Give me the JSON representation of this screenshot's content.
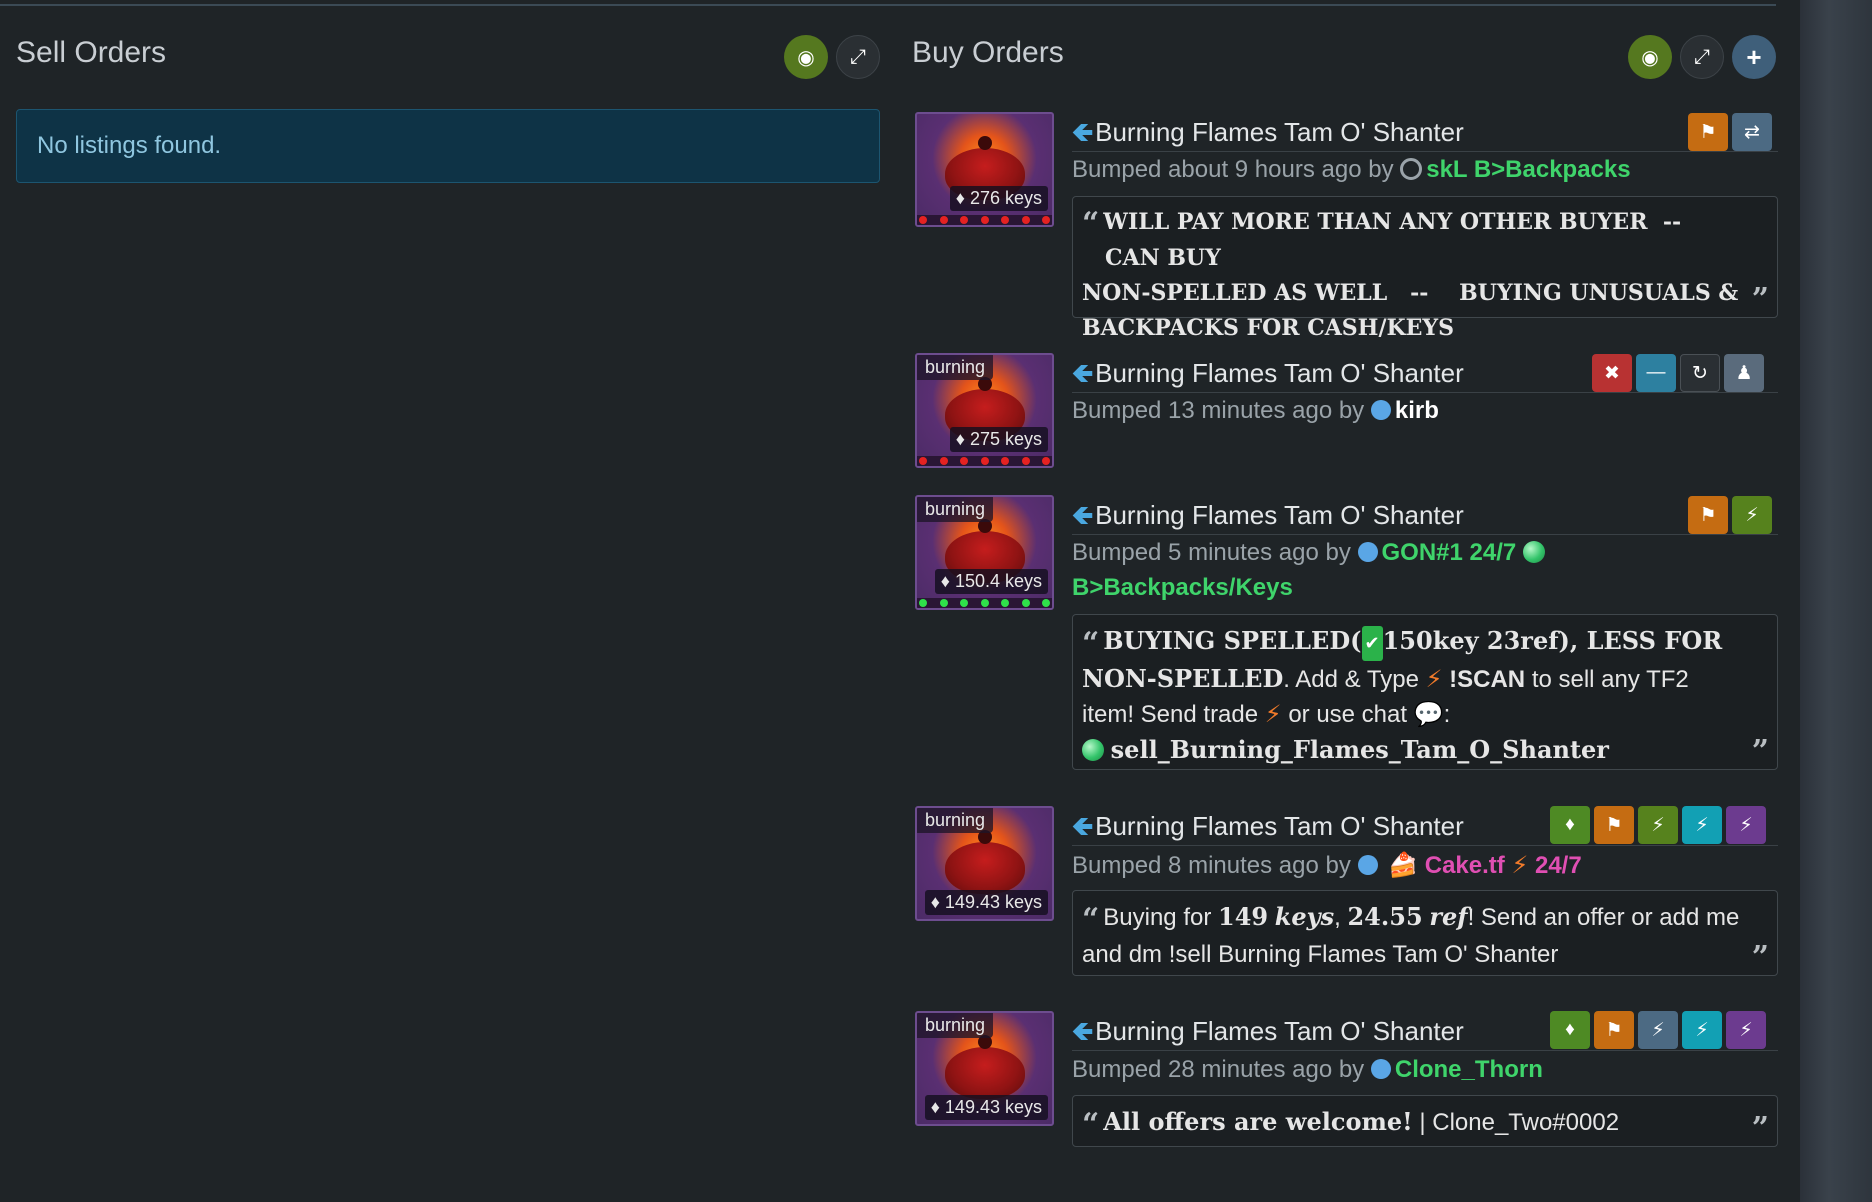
{
  "sell": {
    "title": "Sell Orders",
    "empty_message": "No listings found."
  },
  "buy": {
    "title": "Buy Orders"
  },
  "icons": {
    "eye_off": "eye-slash-icon",
    "expand": "expand-icon",
    "plus": "plus-icon",
    "flag": "flag-icon",
    "exchange": "exchange-icon",
    "remove": "remove-icon",
    "minus": "minus-icon",
    "retweet": "retweet-icon",
    "add_friend": "user-plus-icon",
    "bolt": "bolt-icon",
    "tags": "tags-icon",
    "tag": "tag-icon",
    "arrow": "arrow-left-icon"
  },
  "colors": {
    "accent_blue": "#4aa8e0",
    "unusual_purple": "#6d4d8f",
    "user_green": "#3fd46b",
    "user_pink": "#e04fb3"
  },
  "listings": [
    {
      "item_name": "Burning Flames Tam O' Shanter",
      "price": "276 keys",
      "quality_tag": "",
      "bumped": "Bumped about 9 hours ago by",
      "user": "skL B>Backpacks",
      "message_lines": [
        "WILL PAY MORE THAN ANY OTHER BUYER",
        "--",
        "CAN BUY",
        "NON-SPELLED AS WELL",
        "--",
        "BUYING UNUSUALS &",
        "BACKPACKS FOR CASH/KEYS"
      ]
    },
    {
      "item_name": "Burning Flames Tam O' Shanter",
      "price": "275 keys",
      "quality_tag": "burning",
      "bumped": "Bumped 13 minutes ago by",
      "user": "kirb"
    },
    {
      "item_name": "Burning Flames Tam O' Shanter",
      "price": "150.4 keys",
      "quality_tag": "burning",
      "bumped": "Bumped 5 minutes ago by",
      "user": "GON#1 24/7",
      "user_line2": "B>Backpacks/Keys",
      "msg": {
        "a": "BUYING SPELLED(",
        "b": "150key 23ref",
        "c": "), LESS FOR NON-SPELLED",
        "d": ". Add & Type",
        "e": "!SCAN",
        "f": "to sell any TF2 item! Send trade",
        "g": "or  use  chat",
        "h": ":",
        "i": "sell_Burning_Flames_Tam_O_Shanter"
      }
    },
    {
      "item_name": "Burning Flames Tam O' Shanter",
      "price": "149.43 keys",
      "quality_tag": "burning",
      "bumped": "Bumped 8 minutes ago by",
      "user": "Cake.tf",
      "user_suffix": "24/7",
      "msg": {
        "a": "Buying for",
        "b": "149",
        "c": "keys",
        "d": ",",
        "e": "24.55",
        "f": "ref",
        "g": "! Send an offer or add me and dm !sell Burning Flames Tam O' Shanter"
      }
    },
    {
      "item_name": "Burning Flames Tam O' Shanter",
      "price": "149.43 keys",
      "quality_tag": "burning",
      "bumped": "Bumped 28 minutes ago by",
      "user": "Clone_Thorn",
      "msg": {
        "a": "All offers are welcome!",
        "b": "| Clone_Two#0002"
      }
    }
  ]
}
